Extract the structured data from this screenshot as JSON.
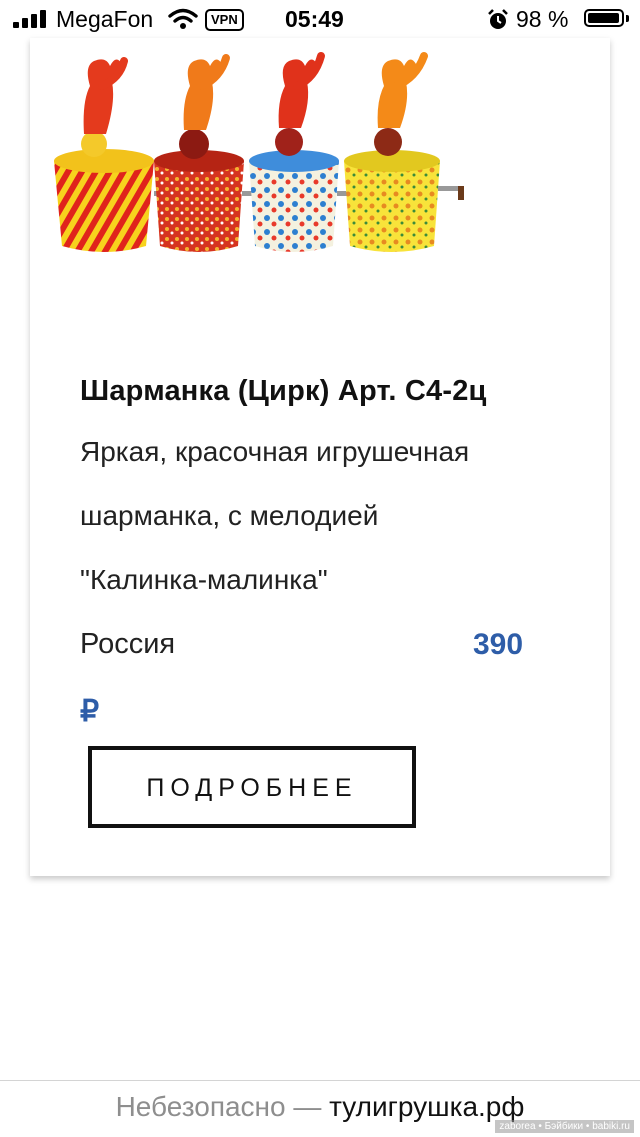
{
  "status_bar": {
    "carrier": "MegaFon",
    "vpn": "VPN",
    "time": "05:49",
    "battery_percent": "98 %",
    "battery_level": 0.98,
    "icons": [
      "signal-icon",
      "wifi-icon",
      "alarm-icon",
      "battery-icon"
    ]
  },
  "product": {
    "title": "Шарманка (Цирк) Арт. С4-2ц",
    "description_lines": [
      "Яркая, красочная игрушечная",
      "шарманка, с мелодией",
      "\"Калинка-малинка\""
    ],
    "origin": "Россия",
    "price": "390",
    "currency": "₽",
    "details_label": "ПОДРОБНЕЕ",
    "price_color": "#2e5da8"
  },
  "address_bar": {
    "security_label": "Небезопасно —",
    "domain": "тулигрушка.рф"
  },
  "watermark": "zaborea • Бэйбики • babiki.ru"
}
